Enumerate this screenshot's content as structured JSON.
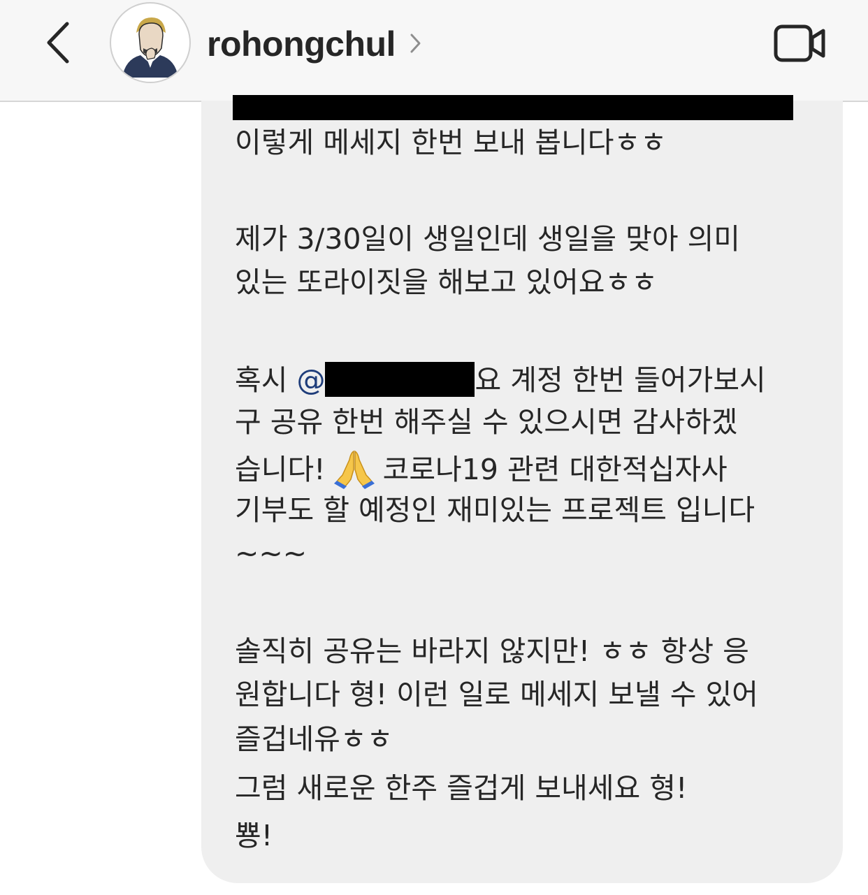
{
  "header": {
    "username": "rohongchul",
    "back_icon": "chevron-left-icon",
    "profile_chevron_icon": "chevron-right-icon",
    "video_icon": "video-camera-icon"
  },
  "message": {
    "line1": "이렇게 메세지 한번 보내 봅니다ㅎㅎ",
    "line2": "제가 3/30일이 생일인데 생일을 맞아 의미",
    "line3": "있는 또라이짓을 해보고 있어요ㅎㅎ",
    "line4_prefix": "혹시 ",
    "mention_at": "@",
    "line4_suffix": "요 계정 한번 들어가보시",
    "line5": "구 공유 한번 해주실 수 있으시면 감사하겠",
    "line6_prefix": "습니다!",
    "emoji": "folded-hands-emoji",
    "line6_suffix": "코로나19 관련 대한적십자사",
    "line7": "기부도 할 예정인 재미있는 프로젝트 입니다",
    "line8": "~~~",
    "line9": "솔직히 공유는 바라지 않지만! ㅎㅎ 항상 응",
    "line10": "원합니다 형! 이런 일로 메세지 보낼 수 있어",
    "line11": "즐겁네유ㅎㅎ",
    "line12": "그럼 새로운 한주 즐겁게 보내세요 형!",
    "line13": "뿅!"
  },
  "colors": {
    "header_bg": "#f7f7f7",
    "bubble_bg": "#efefef",
    "text": "#262626",
    "mention": "#1f3d7a"
  }
}
